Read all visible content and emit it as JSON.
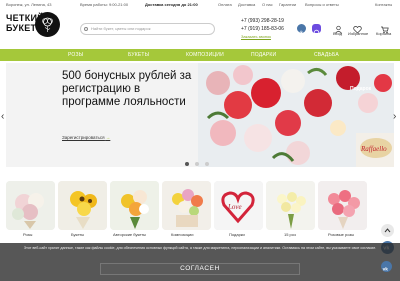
{
  "topbar": {
    "city": "Воронеж, ул. Ленина, 43",
    "hours": "Время работы: 9:00-21:00",
    "delivery": "Доставка сегодня до 21:00",
    "links": [
      "Оплата",
      "Доставка",
      "О нас",
      "Гарантии",
      "Вопросы и ответы",
      "Контакты"
    ]
  },
  "logo": {
    "line1": "ЧЕТКИЙ",
    "line2": "БУКЕТ"
  },
  "search": {
    "placeholder": "Найти букет, цветы или подарок"
  },
  "contacts": {
    "phone1": "+7 (993) 298-28-19",
    "phone2": "+7 (919) 185-83-06",
    "callback": "Заказать звонок"
  },
  "header_icons": [
    {
      "label": "Вход",
      "icon": "user-icon"
    },
    {
      "label": "Избранное",
      "icon": "heart-icon"
    },
    {
      "label": "Корзина",
      "icon": "cart-icon"
    }
  ],
  "nav": [
    "РОЗЫ",
    "БУКЕТЫ",
    "КОМПОЗИЦИИ",
    "ПОДАРКИ",
    "СВАДЬБА"
  ],
  "banner": {
    "title": "500 бонусных рублей за регистрацию в программе лояльности",
    "link": "Зарегистрироваться",
    "gift_label": "Подарок",
    "slides": 3,
    "active_slide": 1
  },
  "categories": [
    {
      "label": "Розы"
    },
    {
      "label": "Букеты"
    },
    {
      "label": "Авторские букеты"
    },
    {
      "label": "Композиции"
    },
    {
      "label": "Подарки"
    },
    {
      "label": "15 роз"
    },
    {
      "label": "Розовые розы"
    }
  ],
  "cookie": {
    "text": "Этот веб-сайт хранит данные, такие как файлы cookie, для обеспечения основных функций сайта, а также для маркетинга, персонализации и аналитики. Оставаясь на этом сайте, вы указываете свое согласие.",
    "button": "СОГЛАСЕН"
  },
  "colors": {
    "accent": "#a5c83a",
    "cookie_bg": "#3a3a3a"
  }
}
